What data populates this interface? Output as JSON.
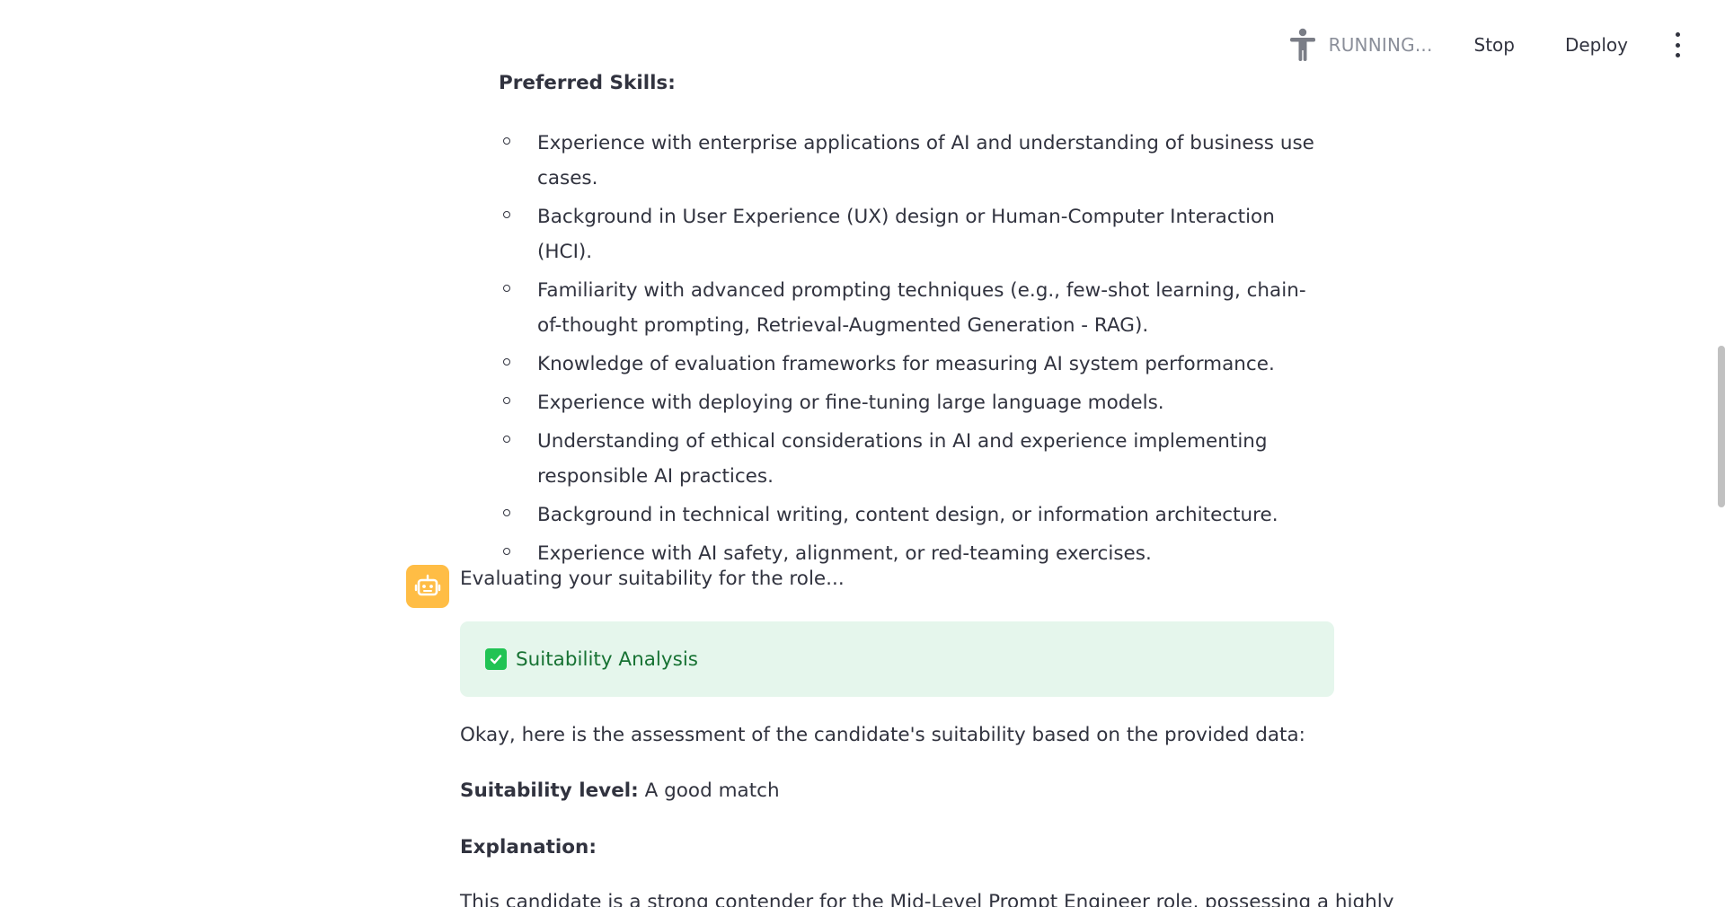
{
  "toolbar": {
    "running_label": "RUNNING...",
    "stop_label": "Stop",
    "deploy_label": "Deploy",
    "running_icon": "person-running-icon",
    "menu_icon": "kebab-menu-icon"
  },
  "preferred_skills": {
    "title": "Preferred Skills:",
    "items": [
      "Experience with enterprise applications of AI and understanding of business use cases.",
      "Background in User Experience (UX) design or Human-Computer Interaction (HCI).",
      "Familiarity with advanced prompting techniques (e.g., few-shot learning, chain-of-thought prompting, Retrieval-Augmented Generation - RAG).",
      "Knowledge of evaluation frameworks for measuring AI system performance.",
      "Experience with deploying or fine-tuning large language models.",
      "Understanding of ethical considerations in AI and experience implementing responsible AI practices.",
      "Background in technical writing, content design, or information architecture.",
      "Experience with AI safety, alignment, or red-teaming exercises."
    ]
  },
  "assistant": {
    "avatar_icon": "robot-icon",
    "avatar_color": "#ffbd45",
    "message": "Evaluating your suitability for the role...",
    "status": {
      "label": "Suitability Analysis",
      "icon": "check-square-icon",
      "bg_color": "#e5f6ec",
      "text_color": "#177233"
    },
    "intro": "Okay, here is the assessment of the candidate's suitability based on the provided data:",
    "suitability_label": "Suitability level:",
    "suitability_value": "A good match",
    "explanation_label": "Explanation:",
    "explanation_text": "This candidate is a strong contender for the Mid-Level Prompt Engineer role, possessing a highly"
  }
}
